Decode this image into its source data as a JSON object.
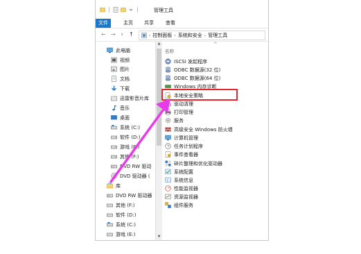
{
  "window": {
    "title": "管理工具"
  },
  "ribbon": {
    "tabs": [
      "文件",
      "主页",
      "共享",
      "查看"
    ]
  },
  "address": {
    "crumbs": [
      "控制面板",
      "系统和安全",
      "管理工具"
    ]
  },
  "nav": {
    "items": [
      {
        "label": "此电脑",
        "icon": "computer-icon"
      },
      {
        "label": "视频",
        "icon": "video-folder-icon"
      },
      {
        "label": "图片",
        "icon": "pictures-folder-icon"
      },
      {
        "label": "文档",
        "icon": "documents-folder-icon"
      },
      {
        "label": "下载",
        "icon": "download-icon"
      },
      {
        "label": "迅雷影音片库",
        "icon": "folder-icon"
      },
      {
        "label": "音乐",
        "icon": "music-icon"
      },
      {
        "label": "桌面",
        "icon": "desktop-icon"
      },
      {
        "label": "系统 (C:)",
        "icon": "drive-icon"
      },
      {
        "label": "软件 (D:)",
        "icon": "drive-icon"
      },
      {
        "label": "游戏 (E:)",
        "icon": "drive-icon"
      },
      {
        "label": "其他 (F:)",
        "icon": "drive-icon"
      },
      {
        "label": "DVD RW 驱动",
        "icon": "dvd-drive-icon"
      },
      {
        "label": "DVD 驱动器 (",
        "icon": "dvd-drive-icon"
      },
      {
        "label": "库",
        "icon": "library-icon"
      },
      {
        "label": "DVD RW 驱动器",
        "icon": "dvd-drive-icon"
      },
      {
        "label": "其他 (F:)",
        "icon": "drive-icon"
      },
      {
        "label": "软件 (D:)",
        "icon": "drive-icon"
      },
      {
        "label": "系统 (C:)",
        "icon": "drive-icon"
      },
      {
        "label": "游戏 (E:)",
        "icon": "drive-icon"
      }
    ]
  },
  "files": {
    "header": "名称",
    "items": [
      {
        "label": "iSCSI 发起程序",
        "icon": "iscsi-icon"
      },
      {
        "label": "ODBC 数据源(32 位)",
        "icon": "odbc-icon"
      },
      {
        "label": "ODBC 数据源(64 位)",
        "icon": "odbc-icon"
      },
      {
        "label": "Windows 内存诊断",
        "icon": "memory-diagnostic-icon"
      },
      {
        "label": "本地安全策略",
        "icon": "security-policy-icon"
      },
      {
        "label": "驱动清理",
        "icon": "cleanup-icon"
      },
      {
        "label": "打印管理",
        "icon": "print-icon"
      },
      {
        "label": "服务",
        "icon": "services-icon"
      },
      {
        "label": "高级安全 Windows 防火墙",
        "icon": "firewall-icon"
      },
      {
        "label": "计算机管理",
        "icon": "computer-management-icon"
      },
      {
        "label": "任务计划程序",
        "icon": "task-scheduler-icon"
      },
      {
        "label": "事件查看器",
        "icon": "event-viewer-icon"
      },
      {
        "label": "碎片整理和优化驱动器",
        "icon": "defrag-icon"
      },
      {
        "label": "系统配置",
        "icon": "system-config-icon"
      },
      {
        "label": "系统信息",
        "icon": "system-info-icon"
      },
      {
        "label": "性能监视器",
        "icon": "performance-icon"
      },
      {
        "label": "资源监视器",
        "icon": "resource-monitor-icon"
      },
      {
        "label": "组件服务",
        "icon": "component-services-icon"
      }
    ]
  },
  "colors": {
    "accent": "#1979ca",
    "highlight": "#e8242c",
    "arrow": "#e83ae8"
  }
}
